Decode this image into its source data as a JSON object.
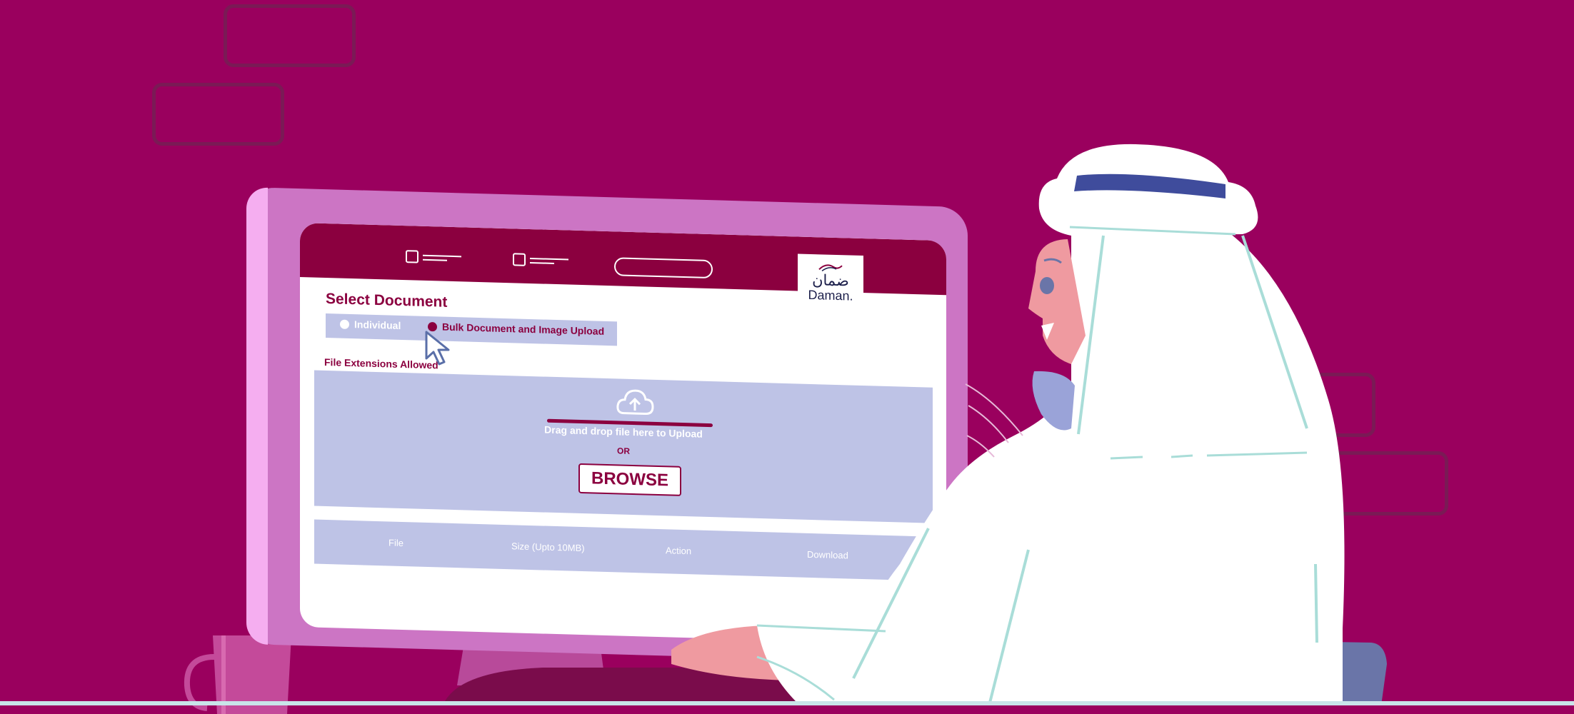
{
  "brand": {
    "name_en": "Daman.",
    "name_ar": "ضمان"
  },
  "colors": {
    "background": "#9a005e",
    "header": "#8b003f",
    "panel": "#bec3e6",
    "monitor": "#cc75c4"
  },
  "header": {
    "icons": [
      "checkbox-icon",
      "checkbox-icon",
      "search-pill-icon"
    ]
  },
  "form": {
    "title": "Select Document",
    "options": [
      {
        "label": "Individual",
        "selected": false
      },
      {
        "label": "Bulk Document and Image Upload",
        "selected": true
      }
    ],
    "extensions_label": "File Extensions Allowed"
  },
  "dropzone": {
    "icon": "cloud-upload-icon",
    "text": "Drag and drop file here to Upload",
    "or": "OR",
    "browse_label": "BROWSE"
  },
  "table": {
    "columns": [
      "File",
      "Size (Upto 10MB)",
      "Action",
      "Download"
    ]
  }
}
